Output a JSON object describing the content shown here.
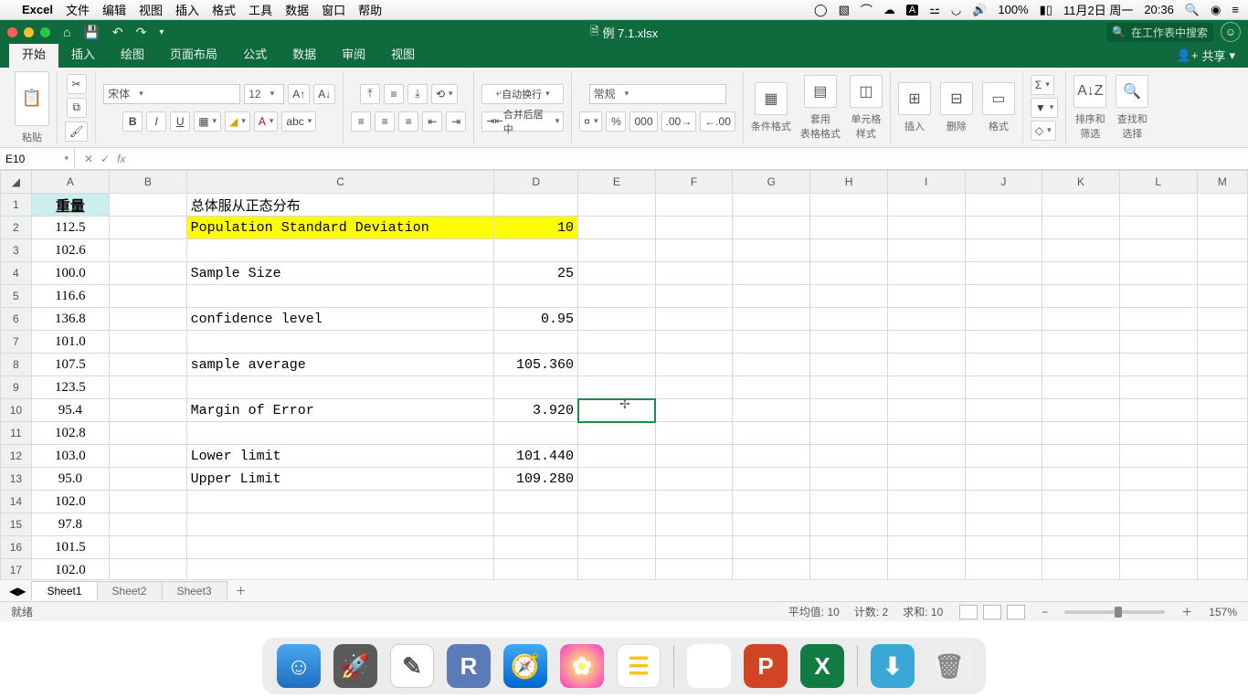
{
  "menubar": {
    "app": "Excel",
    "items": [
      "文件",
      "编辑",
      "视图",
      "插入",
      "格式",
      "工具",
      "数据",
      "窗口",
      "帮助"
    ],
    "battery": "100%",
    "date": "11月2日 周一",
    "time": "20:36"
  },
  "titlebar": {
    "filename": "例 7.1.xlsx",
    "search_placeholder": "在工作表中搜索"
  },
  "ribbon": {
    "tabs": [
      "开始",
      "插入",
      "绘图",
      "页面布局",
      "公式",
      "数据",
      "审阅",
      "视图"
    ],
    "active_tab": "开始",
    "share": "共享",
    "paste": "粘贴",
    "font_name": "宋体",
    "font_size": "12",
    "wrap": "自动换行",
    "merge": "合并后居中",
    "number_format": "常规",
    "cond_fmt": "条件格式",
    "table_fmt": "套用\n表格格式",
    "cell_style": "单元格\n样式",
    "insert": "插入",
    "delete": "删除",
    "format": "格式",
    "sort": "排序和\n筛选",
    "find": "查找和\n选择"
  },
  "fx": {
    "cell": "E10",
    "formula": ""
  },
  "columns": [
    "A",
    "B",
    "C",
    "D",
    "E",
    "F",
    "G",
    "H",
    "I",
    "J",
    "K",
    "L",
    "M"
  ],
  "rows": [
    1,
    2,
    3,
    4,
    5,
    6,
    7,
    8,
    9,
    10,
    11,
    12,
    13,
    14,
    15,
    16,
    17
  ],
  "cells": {
    "A1": "重量",
    "C1": "总体服从正态分布",
    "A2": "112.5",
    "C2": "Population Standard Deviation",
    "D2": "10",
    "A3": "102.6",
    "A4": "100.0",
    "C4": "Sample Size",
    "D4": "25",
    "A5": "116.6",
    "A6": "136.8",
    "C6": "confidence level",
    "D6": "0.95",
    "A7": "101.0",
    "A8": "107.5",
    "C8": "sample average",
    "D8": "105.360",
    "A9": "123.5",
    "A10": "95.4",
    "C10": "Margin of Error",
    "D10": "3.920",
    "A11": "102.8",
    "A12": "103.0",
    "C12": "Lower limit",
    "D12": "101.440",
    "A13": "95.0",
    "C13": "Upper Limit",
    "D13": "109.280",
    "A14": "102.0",
    "A15": "97.8",
    "A16": "101.5",
    "A17": "102.0"
  },
  "selected_cell": "E10",
  "sheet_tabs": [
    "Sheet1",
    "Sheet2",
    "Sheet3"
  ],
  "active_sheet": "Sheet1",
  "status": {
    "ready": "就绪",
    "avg_label": "平均值:",
    "avg": "10",
    "count_label": "计数:",
    "count": "2",
    "sum_label": "求和:",
    "sum": "10",
    "zoom": "157%"
  },
  "chart_data": {
    "type": "table",
    "title": "Confidence interval for population mean (known σ)",
    "parameters": {
      "distribution": "Normal (总体服从正态分布)",
      "population_std_dev": 10,
      "sample_size": 25,
      "confidence_level": 0.95,
      "sample_average": 105.36,
      "margin_of_error": 3.92,
      "lower_limit": 101.44,
      "upper_limit": 109.28
    },
    "sample_values_label": "重量",
    "sample_values": [
      112.5,
      102.6,
      100.0,
      116.6,
      136.8,
      101.0,
      107.5,
      123.5,
      95.4,
      102.8,
      103.0,
      95.0,
      102.0,
      97.8,
      101.5,
      102.0
    ]
  }
}
